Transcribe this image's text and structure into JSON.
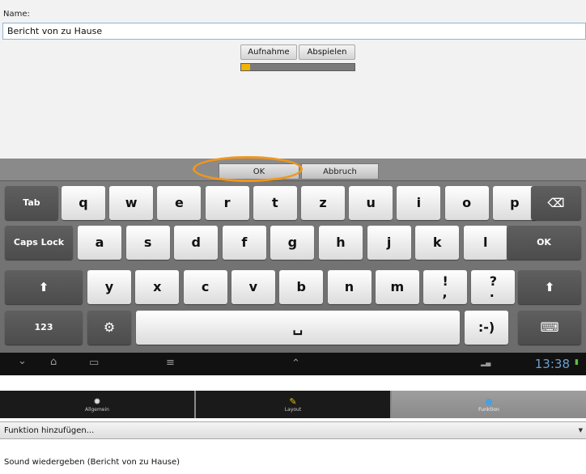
{
  "dialog": {
    "name_label": "Name:",
    "name_value": "Bericht von zu Hause",
    "record_label": "Aufnahme",
    "play_label": "Abspielen",
    "progress": 0.08,
    "progress_color": "#f2b400"
  },
  "keyboard": {
    "ok_label": "OK",
    "cancel_label": "Abbruch",
    "highlight_color": "#f0961e",
    "row1": [
      "q",
      "w",
      "e",
      "r",
      "t",
      "z",
      "u",
      "i",
      "o",
      "p"
    ],
    "row2": [
      "a",
      "s",
      "d",
      "f",
      "g",
      "h",
      "j",
      "k",
      "l"
    ],
    "row3": [
      "y",
      "x",
      "c",
      "v",
      "b",
      "n",
      "m",
      "!\n,",
      "?\n."
    ],
    "tab_key": "Tab",
    "backspace_icon": "backspace-icon",
    "caps_key": "Caps Lock",
    "enter_key": "OK",
    "shift_icon": "shift-arrow-icon",
    "num_key": "123",
    "settings_icon": "gear-icon",
    "space_icon": "space-bar-icon",
    "smiley_key": ":-)",
    "hide_icon": "keyboard-hide-icon"
  },
  "system_bar": {
    "back_icon": "back-chevron-icon",
    "home_icon": "home-icon",
    "recent_icon": "recent-apps-icon",
    "menu_icon": "menu-icon",
    "up_icon": "chevron-up-icon",
    "time": "13:38"
  },
  "tabs": [
    {
      "label": "Allgemein",
      "icon": "general-icon",
      "active": false
    },
    {
      "label": "Layout",
      "icon": "layout-icon",
      "active": false
    },
    {
      "label": "Funktion",
      "icon": "function-icon",
      "active": true
    }
  ],
  "function_dropdown": "Funktion hinzufügen...",
  "function_item": "Sound wiedergeben (Bericht von zu Hause)"
}
